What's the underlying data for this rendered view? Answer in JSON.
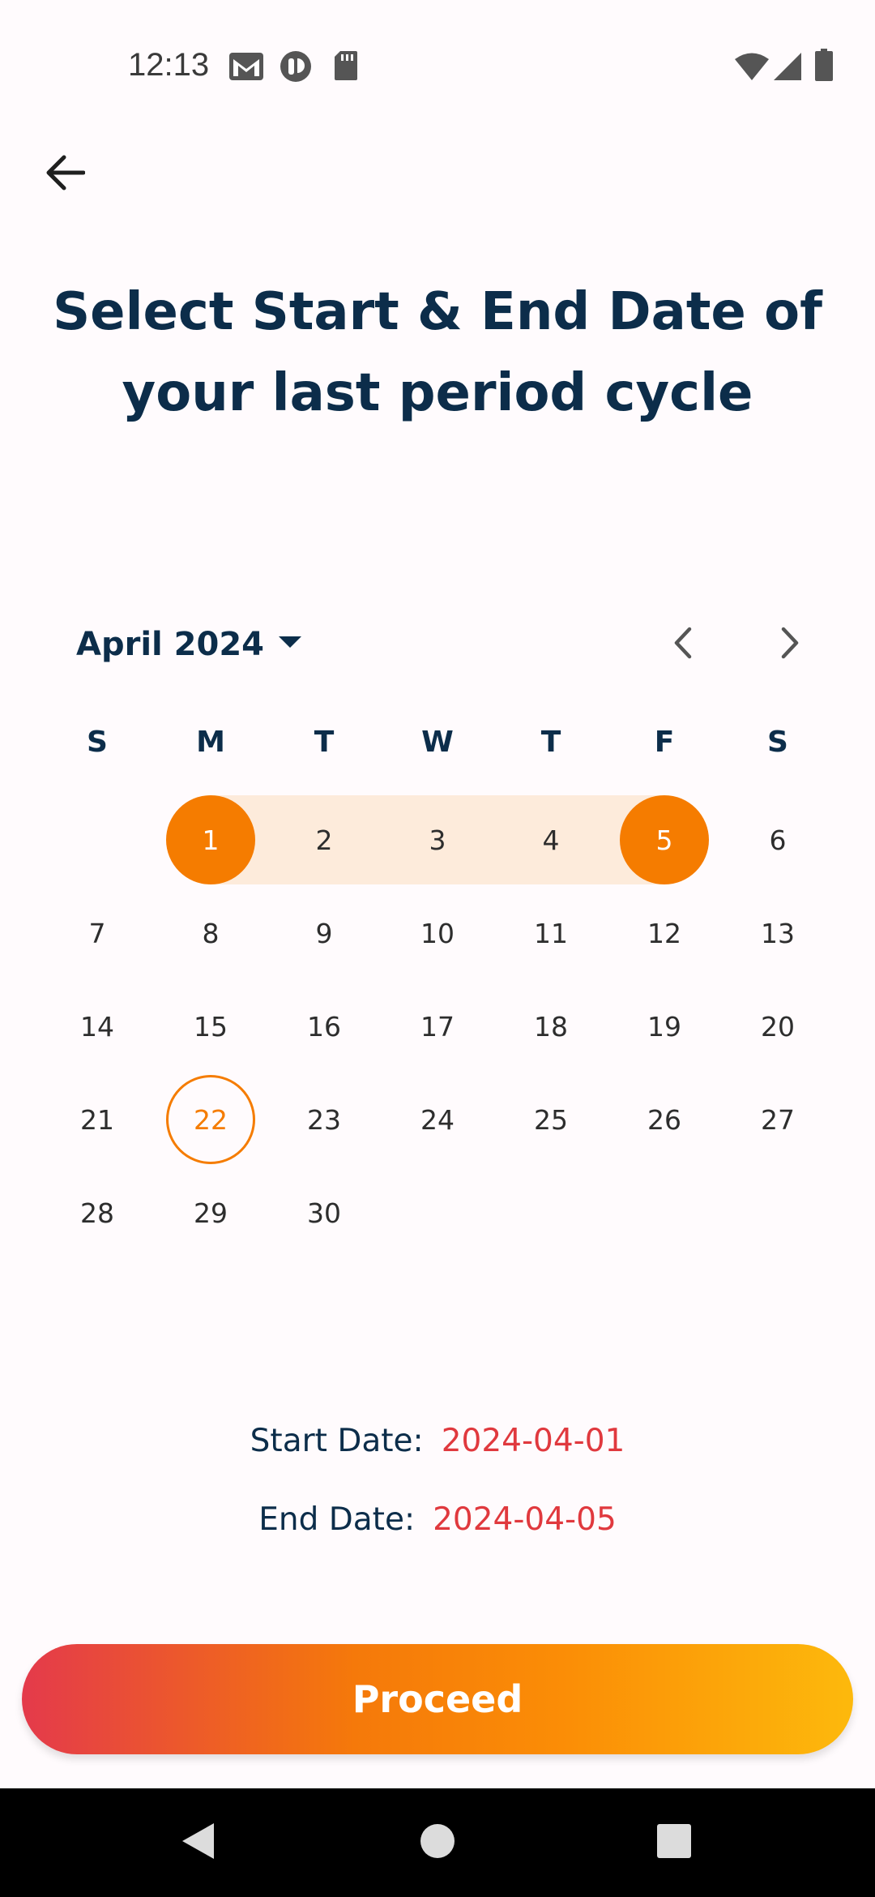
{
  "status_bar": {
    "time": "12:13",
    "left_icons": [
      "gmail-icon",
      "app-notification-icon",
      "sd-card-icon"
    ],
    "right_icons": [
      "wifi-icon",
      "signal-icon",
      "battery-icon"
    ]
  },
  "header": {
    "back_icon": "arrow-left-icon",
    "title": "Select Start & End Date of your last period cycle"
  },
  "calendar": {
    "month_label": "April 2024",
    "weekdays": [
      "S",
      "M",
      "T",
      "W",
      "T",
      "F",
      "S"
    ],
    "first_weekday_index": 1,
    "days_in_month": 30,
    "range_start": 1,
    "range_end": 5,
    "today": 22,
    "accent_color": "#f57c00",
    "range_fill_color": "#fdebdb"
  },
  "selection": {
    "start_label": "Start Date:",
    "start_value": "2024-04-01",
    "end_label": "End Date:",
    "end_value": "2024-04-05"
  },
  "actions": {
    "proceed_label": "Proceed"
  },
  "system_nav": [
    "back-icon",
    "home-icon",
    "recents-icon"
  ]
}
